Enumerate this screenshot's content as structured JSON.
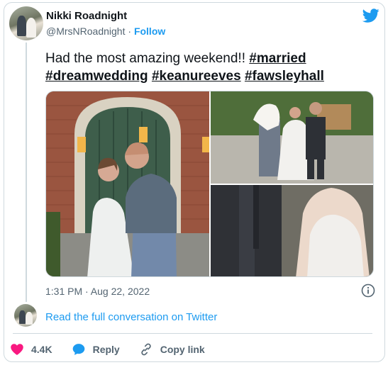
{
  "tweet": {
    "author_name": "Nikki Roadnight",
    "handle": "@MrsNRoadnight",
    "separator": "·",
    "follow_label": "Follow",
    "text_plain": "Had the most amazing weekend!!",
    "hashtags": [
      "#married",
      "#dreamwedding",
      "#keanureeves",
      "#fawsleyhall"
    ],
    "timestamp": "1:31 PM · Aug 22, 2022",
    "read_more": "Read the full conversation on Twitter"
  },
  "actions": {
    "likes_count": "4.4K",
    "reply_label": "Reply",
    "copy_link_label": "Copy link"
  },
  "icons": {
    "brand": "twitter-bird-icon",
    "like": "heart-icon",
    "reply": "speech-bubble-icon",
    "copy": "link-icon",
    "info": "info-icon"
  },
  "colors": {
    "accent": "#1d9bf0",
    "like": "#f91880",
    "text": "#0f1419",
    "muted": "#536471",
    "border": "#cfd9de"
  }
}
